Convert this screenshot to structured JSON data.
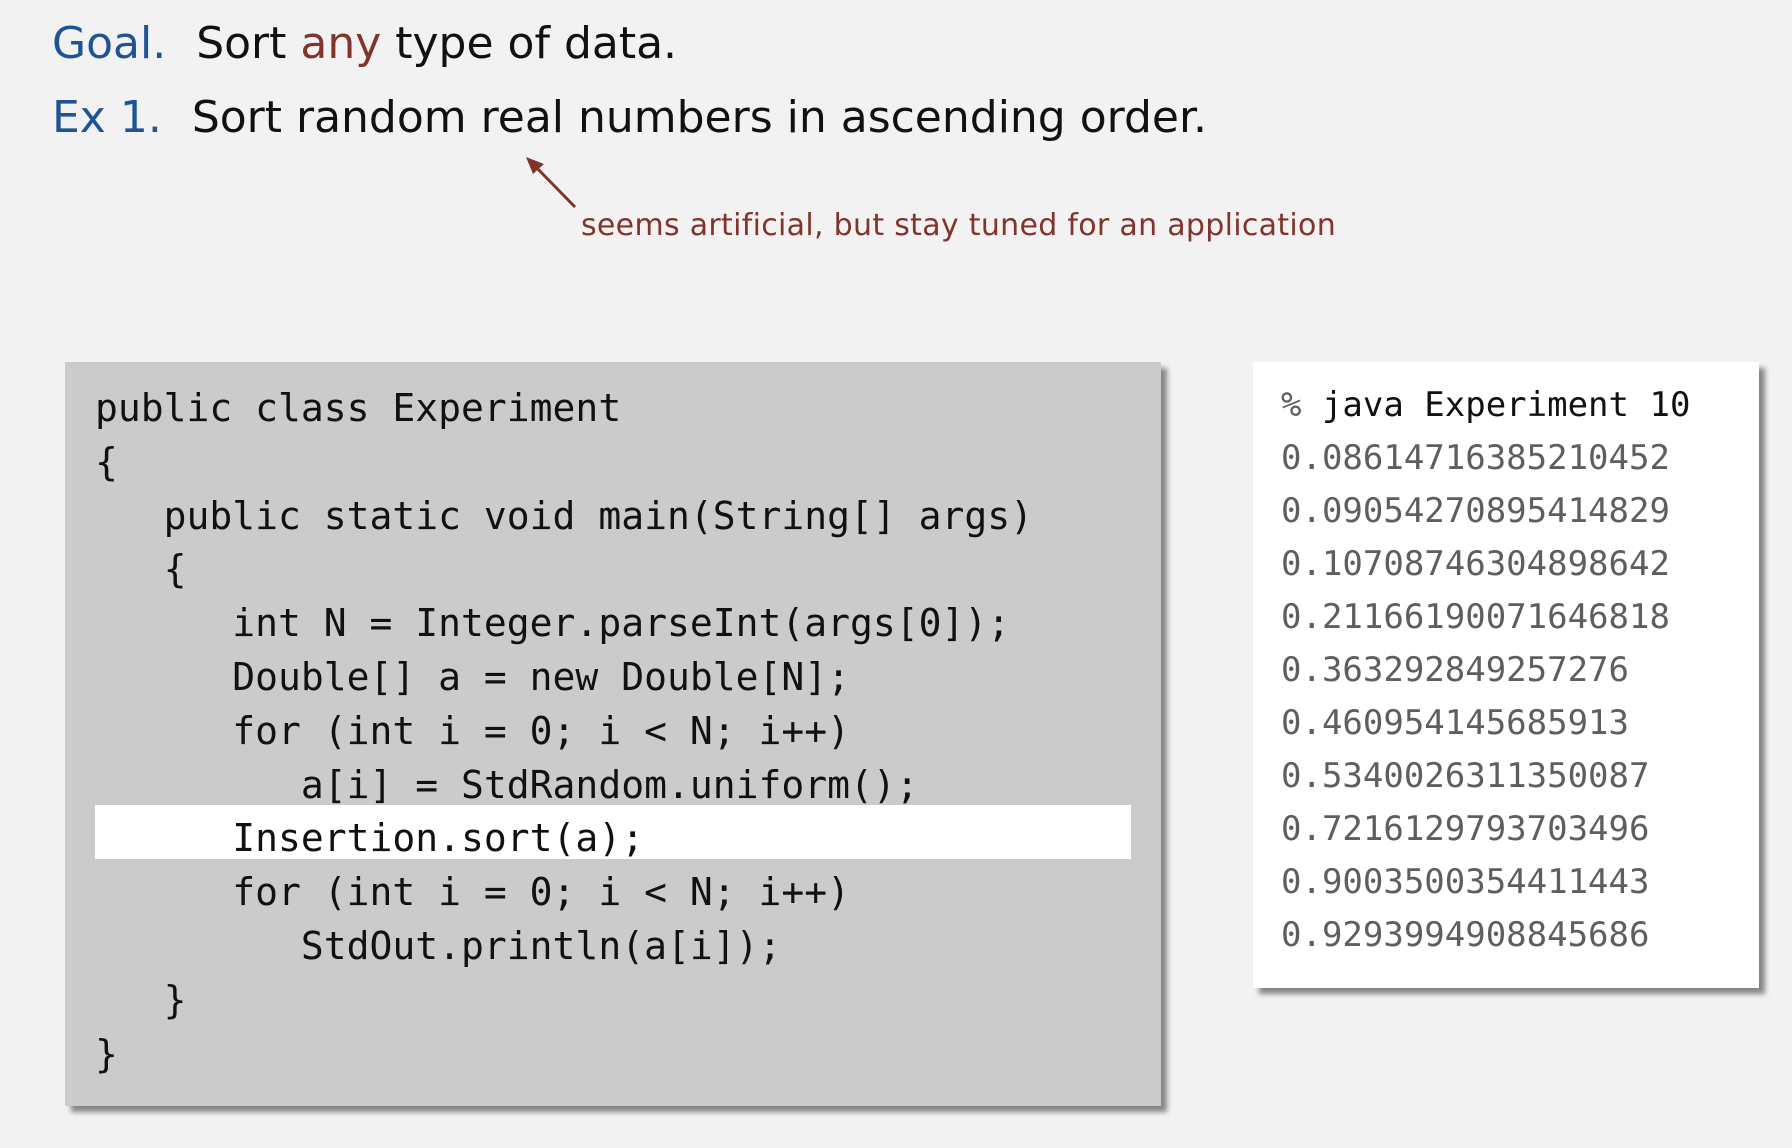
{
  "goal": {
    "label": "Goal.",
    "text_before": "Sort ",
    "highlight": "any",
    "text_after": " type of data."
  },
  "example": {
    "label": "Ex 1.",
    "text": "Sort random real numbers in ascending order."
  },
  "annotation": {
    "text": "seems artificial, but stay tuned for an application"
  },
  "code": {
    "lines": [
      "public class Experiment",
      "{",
      "   public static void main(String[] args)",
      "   {",
      "      int N = Integer.parseInt(args[0]);",
      "      Double[] a = new Double[N];",
      "      for (int i = 0; i < N; i++)",
      "         a[i] = StdRandom.uniform();",
      "      Insertion.sort(a);",
      "      for (int i = 0; i < N; i++)",
      "         StdOut.println(a[i]);",
      "   }",
      "}"
    ],
    "highlighted_line": 8
  },
  "terminal": {
    "prompt": "%",
    "command": " java Experiment 10",
    "output": [
      "0.08614716385210452",
      "0.09054270895414829",
      "0.10708746304898642",
      "0.21166190071646818",
      "0.363292849257276",
      "0.460954145685913",
      "0.5340026311350087",
      "0.7216129793703496",
      "0.9003500354411443",
      "0.9293994908845686"
    ]
  },
  "colors": {
    "keyword_blue": "#1f5494",
    "highlight_red": "#80342a",
    "background": "#f2f2f2",
    "code_panel": "#cbcbcb"
  }
}
